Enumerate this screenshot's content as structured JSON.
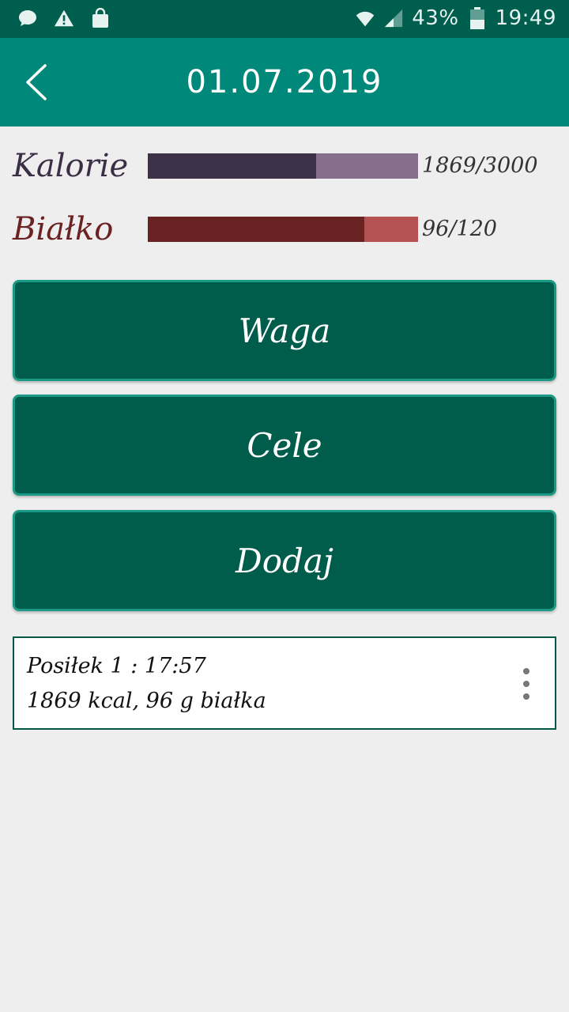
{
  "status_bar": {
    "left_icons": [
      "chat-bubble-icon",
      "warning-icon",
      "shopping-bag-icon"
    ],
    "right_icons": [
      "wifi-icon",
      "signal-icon",
      "battery-icon"
    ],
    "battery": "43%",
    "time": "19:49"
  },
  "toolbar": {
    "title": "01.07.2019",
    "back_icon": "chevron-left-icon"
  },
  "colors": {
    "status_bar": "#005e4e",
    "toolbar": "#00897b",
    "button": "#005c4b",
    "calories_fill": "#3e3249",
    "calories_track": "#866f8c",
    "protein_fill": "#6a2323",
    "protein_track": "#b35250",
    "protein_label": "#6b2222"
  },
  "progress": [
    {
      "key": "calories",
      "label": "Kalorie",
      "current": 1869,
      "goal": 3000,
      "value_text": "1869/3000"
    },
    {
      "key": "protein",
      "label": "Białko",
      "current": 96,
      "goal": 120,
      "value_text": "96/120"
    }
  ],
  "buttons": {
    "weight": "Waga",
    "goals": "Cele",
    "add": "Dodaj"
  },
  "meals": [
    {
      "title": "Posiłek 1 :  17:57",
      "summary": "1869 kcal, 96 g białka",
      "menu_icon": "more-vert-icon"
    }
  ]
}
